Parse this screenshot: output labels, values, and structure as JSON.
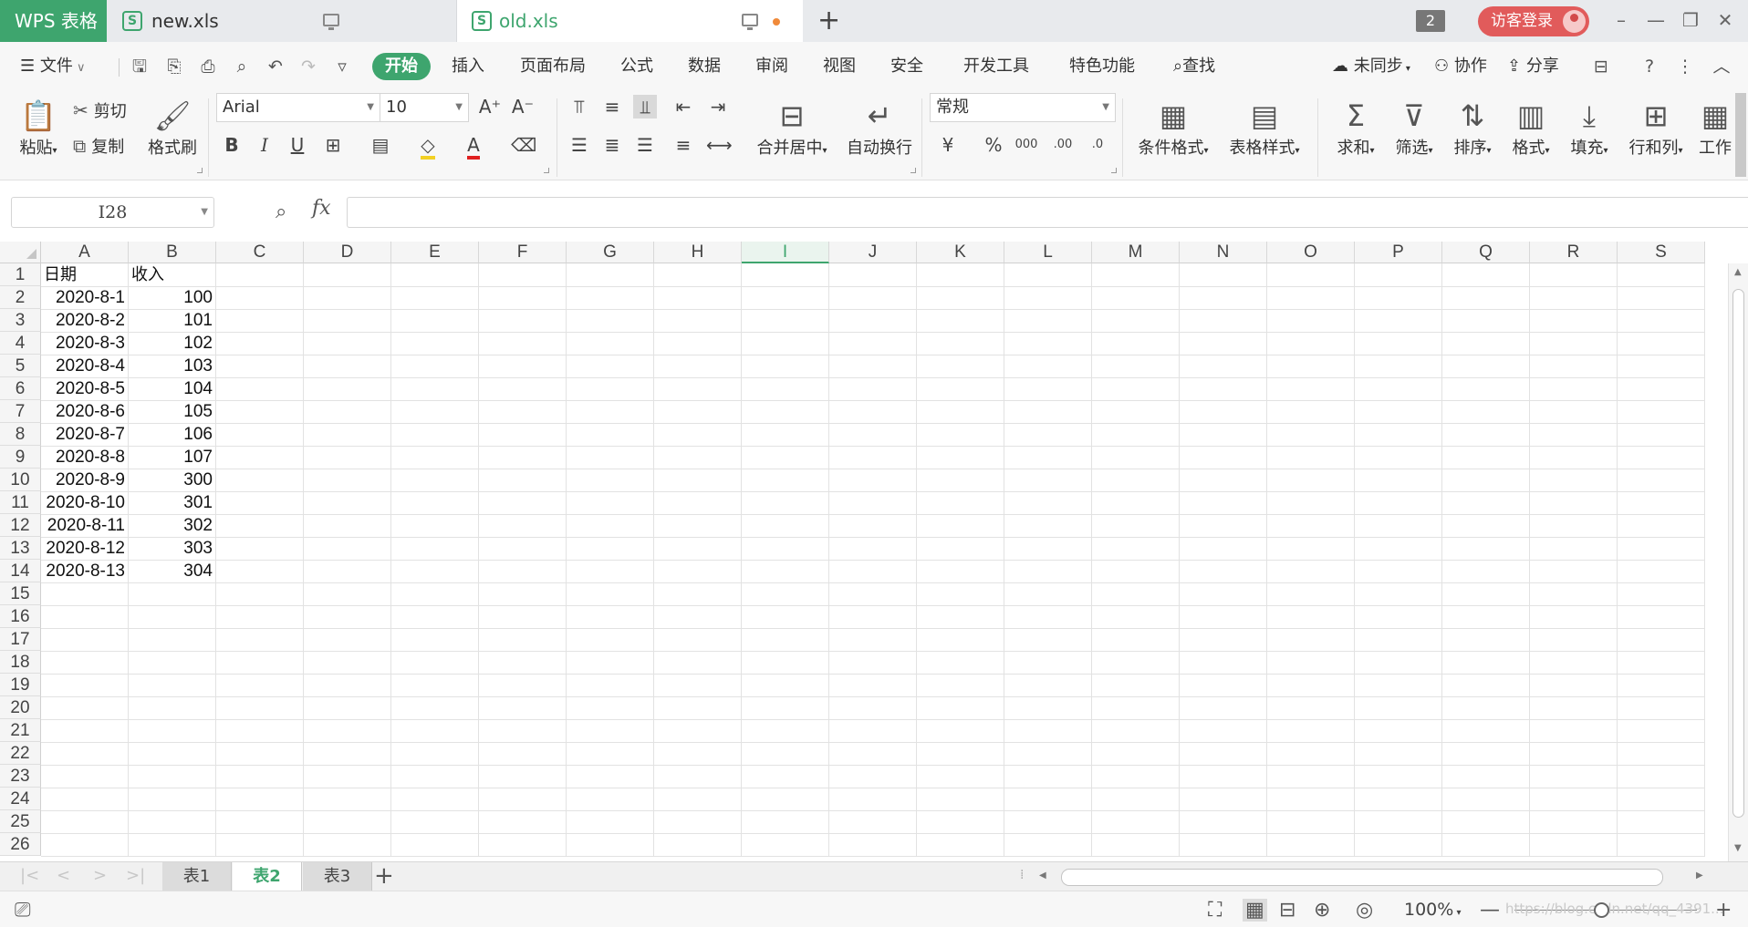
{
  "app": {
    "name": "WPS 表格",
    "tabs": [
      {
        "label": "new.xls",
        "icon": "S"
      },
      {
        "label": "old.xls",
        "icon": "S"
      }
    ],
    "window_count": "2",
    "login_label": "访客登录"
  },
  "menu": {
    "file": "文件",
    "items": [
      "开始",
      "插入",
      "页面布局",
      "公式",
      "数据",
      "审阅",
      "视图",
      "安全",
      "开发工具",
      "特色功能"
    ],
    "search": "查找",
    "sync": "未同步",
    "collab": "协作",
    "share": "分享"
  },
  "ribbon": {
    "paste": "粘贴",
    "cut": "剪切",
    "copy": "复制",
    "format_painter": "格式刷",
    "font_name": "Arial",
    "font_size": "10",
    "merge_center": "合并居中",
    "wrap_text": "自动换行",
    "number_format": "常规",
    "conditional_format": "条件格式",
    "table_style": "表格样式",
    "sum": "求和",
    "filter": "筛选",
    "sort": "排序",
    "format": "格式",
    "fill": "填充",
    "rows_cols": "行和列",
    "worksheet": "工作"
  },
  "formula_bar": {
    "name_box": "I28",
    "fx": "fx",
    "formula": ""
  },
  "grid": {
    "columns": [
      "A",
      "B",
      "C",
      "D",
      "E",
      "F",
      "G",
      "H",
      "I",
      "J",
      "K",
      "L",
      "M",
      "N",
      "O",
      "P",
      "Q",
      "R",
      "S"
    ],
    "active_column": "I",
    "row_numbers": [
      "1",
      "2",
      "3",
      "4",
      "5",
      "6",
      "7",
      "8",
      "9",
      "10",
      "11",
      "12",
      "13",
      "14",
      "15",
      "16",
      "17",
      "18",
      "19",
      "20",
      "21",
      "22",
      "23",
      "24",
      "25",
      "26"
    ],
    "headers": [
      "日期",
      "收入"
    ],
    "rows": [
      [
        "2020-8-1",
        "100"
      ],
      [
        "2020-8-2",
        "101"
      ],
      [
        "2020-8-3",
        "102"
      ],
      [
        "2020-8-4",
        "103"
      ],
      [
        "2020-8-5",
        "104"
      ],
      [
        "2020-8-6",
        "105"
      ],
      [
        "2020-8-7",
        "106"
      ],
      [
        "2020-8-8",
        "107"
      ],
      [
        "2020-8-9",
        "300"
      ],
      [
        "2020-8-10",
        "301"
      ],
      [
        "2020-8-11",
        "302"
      ],
      [
        "2020-8-12",
        "303"
      ],
      [
        "2020-8-13",
        "304"
      ]
    ]
  },
  "sheets": [
    "表1",
    "表2",
    "表3"
  ],
  "active_sheet": "表2",
  "status": {
    "zoom": "100%",
    "watermark": "https://blog.csdn.net/qq_4391..."
  },
  "colors": {
    "accent": "#3ea56e",
    "login": "#e15b5b"
  }
}
